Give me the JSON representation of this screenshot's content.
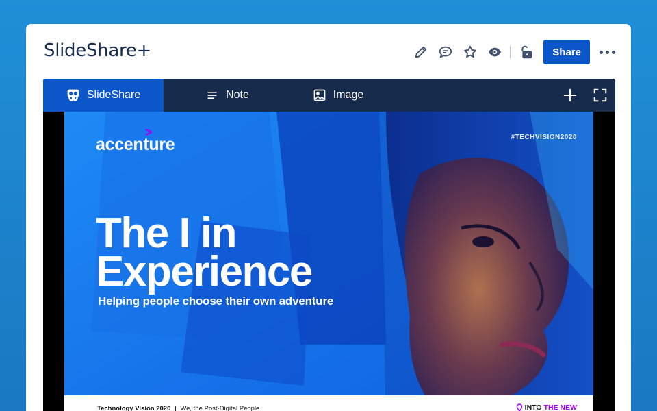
{
  "page": {
    "title": "SlideShare+"
  },
  "toolbar": {
    "icons": [
      "edit-icon",
      "comment-icon",
      "star-icon",
      "watch-icon",
      "restrictions-icon",
      "more-icon"
    ],
    "share_label": "Share"
  },
  "macro": {
    "tabs": [
      {
        "label": "SlideShare",
        "icon": "slideshare-icon",
        "active": true
      },
      {
        "label": "Note",
        "icon": "note-lines-icon",
        "active": false
      },
      {
        "label": "Image",
        "icon": "image-icon",
        "active": false
      }
    ],
    "tools": [
      "add-icon",
      "fullscreen-icon"
    ]
  },
  "slide": {
    "logo": "accenture",
    "hashtag": "#TECHVISION2020",
    "headline_line1": "The I in",
    "headline_line2": "Experience",
    "subhead": "Helping people choose their own adventure",
    "footer_bold": "Technology Vision 2020",
    "footer_sep": "|",
    "footer_text": "We, the Post-Digital People",
    "footer_right_a": "INTO",
    "footer_right_b": "THE NEW"
  },
  "colors": {
    "background": "#1f8fd6",
    "primary": "#0b56c9",
    "tabbar": "#172b4d",
    "slide_blue": "#1a7ff0",
    "accent_purple": "#a100ff"
  }
}
